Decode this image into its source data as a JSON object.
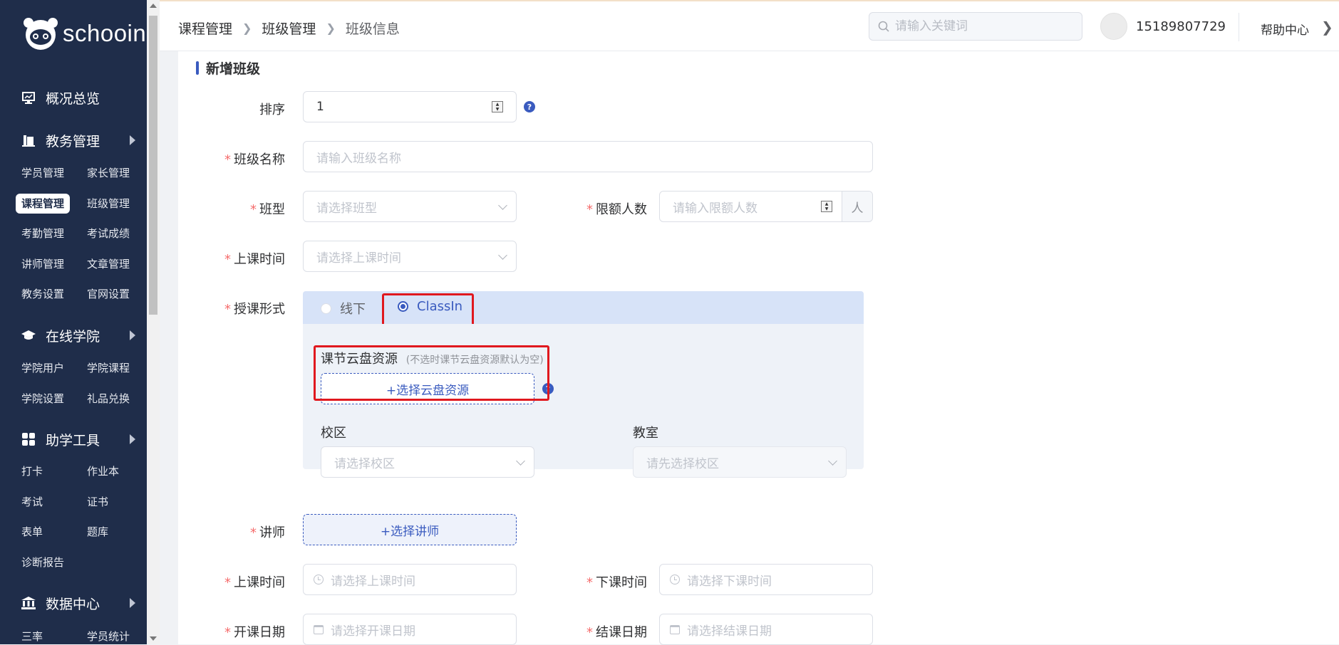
{
  "sidebar": {
    "logo_text": "schooin",
    "groups": [
      {
        "label": "概况总览",
        "icon": "monitor-icon"
      },
      {
        "label": "教务管理",
        "icon": "book-icon"
      },
      {
        "label": "在线学院",
        "icon": "graduation-cap-icon"
      },
      {
        "label": "助学工具",
        "icon": "grid-icon"
      },
      {
        "label": "数据中心",
        "icon": "bank-icon"
      }
    ],
    "edu_items": [
      "学员管理",
      "家长管理",
      "课程管理",
      "班级管理",
      "考勤管理",
      "考试成绩",
      "讲师管理",
      "文章管理",
      "教务设置",
      "官网设置"
    ],
    "academy_items": [
      "学院用户",
      "学院课程",
      "学院设置",
      "礼品兑换"
    ],
    "tool_items": [
      "打卡",
      "作业本",
      "考试",
      "证书",
      "表单",
      "题库",
      "诊断报告"
    ],
    "data_items": [
      "三率",
      "学员统计"
    ],
    "active_item": "课程管理"
  },
  "header": {
    "breadcrumb": [
      "课程管理",
      "班级管理",
      "班级信息"
    ],
    "search_placeholder": "请输入关键词",
    "phone": "15189807729",
    "help": "帮助中心"
  },
  "form": {
    "section_title": "新增班级",
    "order": {
      "label": "排序",
      "value": "1"
    },
    "class_name": {
      "label": "班级名称",
      "placeholder": "请输入班级名称"
    },
    "class_type": {
      "label": "班型",
      "placeholder": "请选择班型"
    },
    "capacity": {
      "label": "限额人数",
      "placeholder": "请输入限额人数",
      "suffix": "人"
    },
    "class_time": {
      "label": "上课时间",
      "placeholder": "请选择上课时间"
    },
    "mode": {
      "label": "授课形式",
      "options": [
        "线下",
        "ClassIn"
      ],
      "selected": "ClassIn",
      "cloud_title": "课节云盘资源",
      "cloud_note": "(不选时课节云盘资源默认为空)",
      "cloud_button": "+选择云盘资源",
      "campus_label": "校区",
      "campus_placeholder": "请选择校区",
      "room_label": "教室",
      "room_placeholder": "请先选择校区"
    },
    "teacher": {
      "label": "讲师",
      "button": "+选择讲师"
    },
    "start_time": {
      "label": "上课时间",
      "placeholder": "请选择上课时间"
    },
    "end_time": {
      "label": "下课时间",
      "placeholder": "请选择下课时间"
    },
    "start_date": {
      "label": "开课日期",
      "placeholder": "请选择开课日期"
    },
    "end_date": {
      "label": "结课日期",
      "placeholder": "请选择结课日期"
    }
  },
  "colors": {
    "sidebar_bg": "#1f2d4a",
    "accent": "#3a5bbf",
    "highlight": "#e0181e",
    "required": "#f56c6c"
  }
}
